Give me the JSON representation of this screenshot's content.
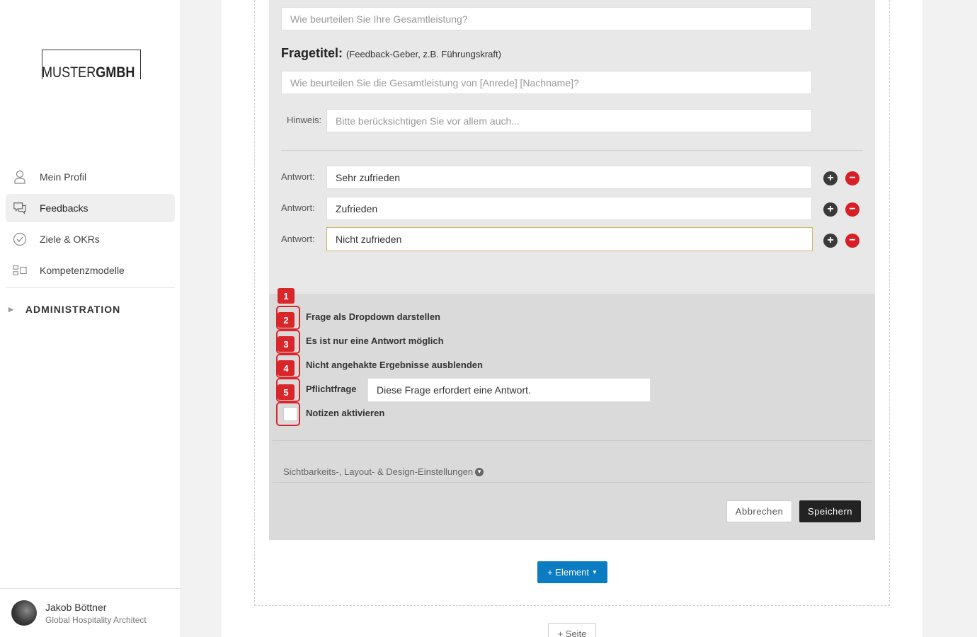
{
  "sidebar": {
    "logo": {
      "light": "MUSTER",
      "bold": "GMBH"
    },
    "nav": [
      {
        "label": "Mein Profil",
        "icon": "user-icon"
      },
      {
        "label": "Feedbacks",
        "icon": "chat-icon",
        "active": true
      },
      {
        "label": "Ziele & OKRs",
        "icon": "check-circle-icon"
      },
      {
        "label": "Kompetenzmodelle",
        "icon": "competence-model-icon"
      }
    ],
    "admin_label": "ADMINISTRATION",
    "user": {
      "name": "Jakob Böttner",
      "role": "Global Hospitality Architect"
    }
  },
  "editor": {
    "self_question_placeholder": "Wie beurteilen Sie Ihre Gesamtleistung?",
    "fragetitel_label": "Fragetitel:",
    "fragetitel_hint": "(Feedback-Geber, z.B. Führungskraft)",
    "feedback_question_placeholder": "Wie beurteilen Sie die Gesamtleistung von [Anrede] [Nachname]?",
    "hinweis_label": "Hinweis:",
    "hinweis_placeholder": "Bitte berücksichtigen Sie vor allem auch...",
    "answer_label": "Antwort:",
    "answers": [
      "Sehr zufrieden",
      "Zufrieden",
      "Nicht zufrieden"
    ],
    "options": [
      {
        "badge": "1",
        "label": ""
      },
      {
        "badge": "2",
        "label": "Frage als Dropdown darstellen"
      },
      {
        "badge": "3",
        "label": "Es ist nur eine Antwort möglich"
      },
      {
        "badge": "4",
        "label": "Nicht angehakte Ergebnisse ausblenden"
      },
      {
        "badge": "5",
        "label": "Pflichtfrage"
      },
      {
        "badge": "",
        "label": "Notizen aktivieren"
      }
    ],
    "pflichtfrage_message": "Diese Frage erfordert eine Antwort.",
    "settings_link": "Sichtbarkeits-, Layout- & Design-Einstellungen",
    "cancel_label": "Abbrechen",
    "save_label": "Speichern"
  },
  "add_element_label": "+ Element",
  "add_page_label": "+ Seite",
  "colors": {
    "accent_blue": "#0b7bc2",
    "badge_red": "#d9262b",
    "minus_red": "#d61f26",
    "focus_border": "#d4b25a"
  }
}
